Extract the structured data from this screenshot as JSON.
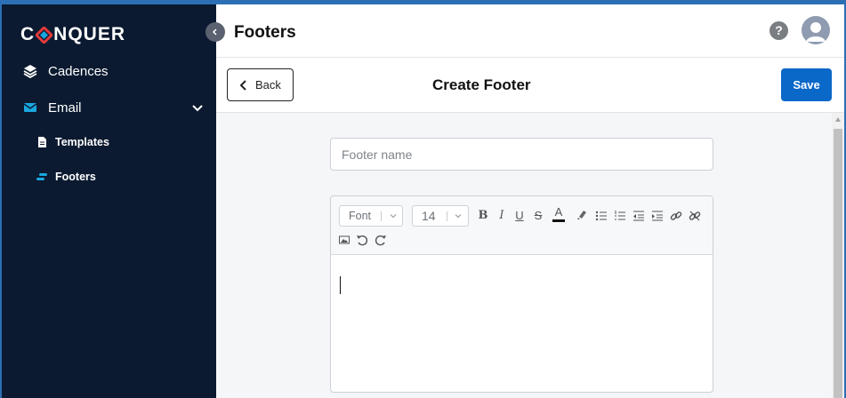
{
  "brand": {
    "logo_text_left": "C",
    "logo_text_right": "NQUER"
  },
  "sidebar": {
    "items": [
      {
        "label": "Cadences",
        "icon": "layers-icon"
      },
      {
        "label": "Email",
        "icon": "envelope-icon"
      },
      {
        "label": "Templates",
        "icon": "document-icon"
      },
      {
        "label": "Footers",
        "icon": "footer-icon"
      }
    ]
  },
  "header": {
    "title": "Footers",
    "help": "?"
  },
  "subheader": {
    "back_label": "Back",
    "title": "Create Footer",
    "save_label": "Save"
  },
  "form": {
    "footer_name_placeholder": "Footer name",
    "footer_name_value": ""
  },
  "editor": {
    "font_select": "Font",
    "size_select": "14",
    "toolbar_icons": [
      "bold-icon",
      "italic-icon",
      "underline-icon",
      "strikethrough-icon",
      "text-color-icon",
      "highlight-icon",
      "bullet-list-icon",
      "numbered-list-icon",
      "outdent-icon",
      "indent-icon",
      "link-icon",
      "unlink-icon",
      "image-icon",
      "undo-icon",
      "redo-icon"
    ],
    "labels": {
      "bold": "B",
      "italic": "I",
      "underline": "U",
      "strike": "S",
      "color": "A"
    }
  },
  "colors": {
    "sidebar_bg": "#0b1a30",
    "accent": "#0a68c9",
    "active_icon": "#1aa7e0"
  }
}
